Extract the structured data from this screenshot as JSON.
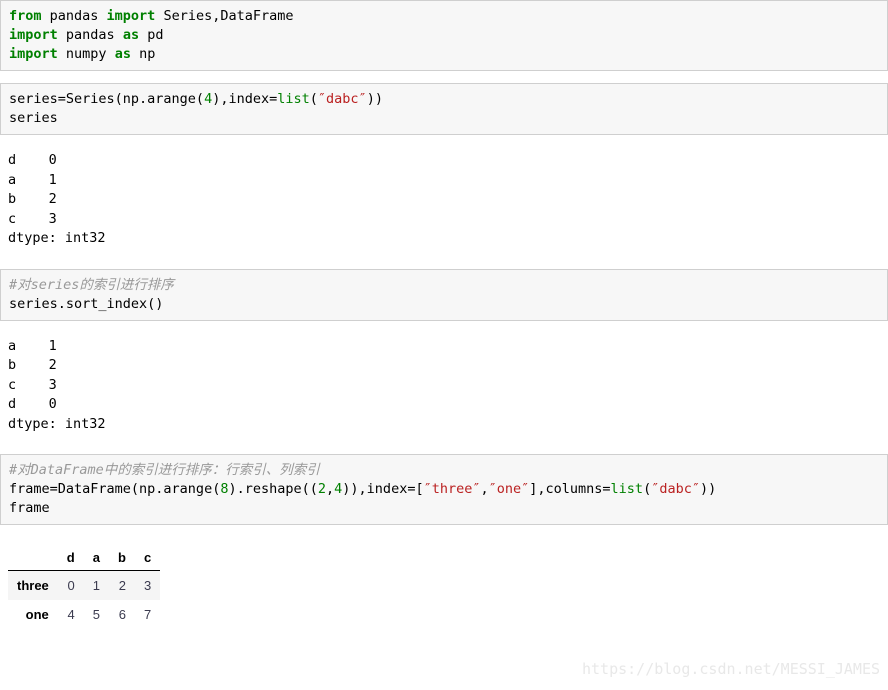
{
  "cells": [
    {
      "type": "input",
      "name": "code-cell-imports",
      "lines": [
        [
          {
            "t": "from",
            "c": "kw"
          },
          {
            "t": " pandas ",
            "c": ""
          },
          {
            "t": "import",
            "c": "kw"
          },
          {
            "t": " Series,DataFrame",
            "c": ""
          }
        ],
        [
          {
            "t": "import",
            "c": "kw"
          },
          {
            "t": " pandas ",
            "c": ""
          },
          {
            "t": "as",
            "c": "kw"
          },
          {
            "t": " pd",
            "c": ""
          }
        ],
        [
          {
            "t": "import",
            "c": "kw"
          },
          {
            "t": " numpy ",
            "c": ""
          },
          {
            "t": "as",
            "c": "kw"
          },
          {
            "t": " np",
            "c": ""
          }
        ]
      ]
    },
    {
      "type": "input",
      "name": "code-cell-create-series",
      "lines": [
        [
          {
            "t": "series=Series(np.arange(",
            "c": ""
          },
          {
            "t": "4",
            "c": "num"
          },
          {
            "t": "),index=",
            "c": ""
          },
          {
            "t": "list",
            "c": "bi"
          },
          {
            "t": "(",
            "c": ""
          },
          {
            "t": "″dabc″",
            "c": "str"
          },
          {
            "t": "))",
            "c": ""
          }
        ],
        [
          {
            "t": "series",
            "c": ""
          }
        ]
      ]
    },
    {
      "type": "output",
      "name": "output-series",
      "lines": [
        "d    0",
        "a    1",
        "b    2",
        "c    3",
        "dtype: int32"
      ]
    },
    {
      "type": "input",
      "name": "code-cell-sort-index",
      "lines": [
        [
          {
            "t": "#对series的索引进行排序",
            "c": "cmt"
          }
        ],
        [
          {
            "t": "series.sort_index()",
            "c": ""
          }
        ]
      ]
    },
    {
      "type": "output",
      "name": "output-series-sorted",
      "lines": [
        "a    1",
        "b    2",
        "c    3",
        "d    0",
        "dtype: int32"
      ]
    },
    {
      "type": "input",
      "name": "code-cell-create-dataframe",
      "lines": [
        [
          {
            "t": "#对DataFrame中的索引进行排序：行索引、列索引",
            "c": "cmt"
          }
        ],
        [
          {
            "t": "frame=DataFrame(np.arange(",
            "c": ""
          },
          {
            "t": "8",
            "c": "num"
          },
          {
            "t": ").reshape((",
            "c": ""
          },
          {
            "t": "2",
            "c": "num"
          },
          {
            "t": ",",
            "c": ""
          },
          {
            "t": "4",
            "c": "num"
          },
          {
            "t": ")),index=[",
            "c": ""
          },
          {
            "t": "″three″",
            "c": "str"
          },
          {
            "t": ",",
            "c": ""
          },
          {
            "t": "″one″",
            "c": "str"
          },
          {
            "t": "],columns=",
            "c": ""
          },
          {
            "t": "list",
            "c": "bi"
          },
          {
            "t": "(",
            "c": ""
          },
          {
            "t": "″dabc″",
            "c": "str"
          },
          {
            "t": "))",
            "c": ""
          }
        ],
        [
          {
            "t": "frame",
            "c": ""
          }
        ]
      ]
    }
  ],
  "dataframe": {
    "name": "output-dataframe-table",
    "corner_label": "",
    "columns": [
      "d",
      "a",
      "b",
      "c"
    ],
    "rows": [
      {
        "index": "three",
        "values": [
          "0",
          "1",
          "2",
          "3"
        ]
      },
      {
        "index": "one",
        "values": [
          "4",
          "5",
          "6",
          "7"
        ]
      }
    ]
  },
  "watermark": {
    "text": "https://blog.csdn.net/MESSI_JAMES"
  },
  "colors": {
    "keyword": "#008000",
    "string": "#ba2121",
    "number": "#008000",
    "builtin": "#008000",
    "comment": "#999999",
    "cell_background": "#f7f7f7",
    "cell_border": "#cfcfcf",
    "table_stripe": "#f5f5f5",
    "watermark": "#e8e8e8"
  }
}
